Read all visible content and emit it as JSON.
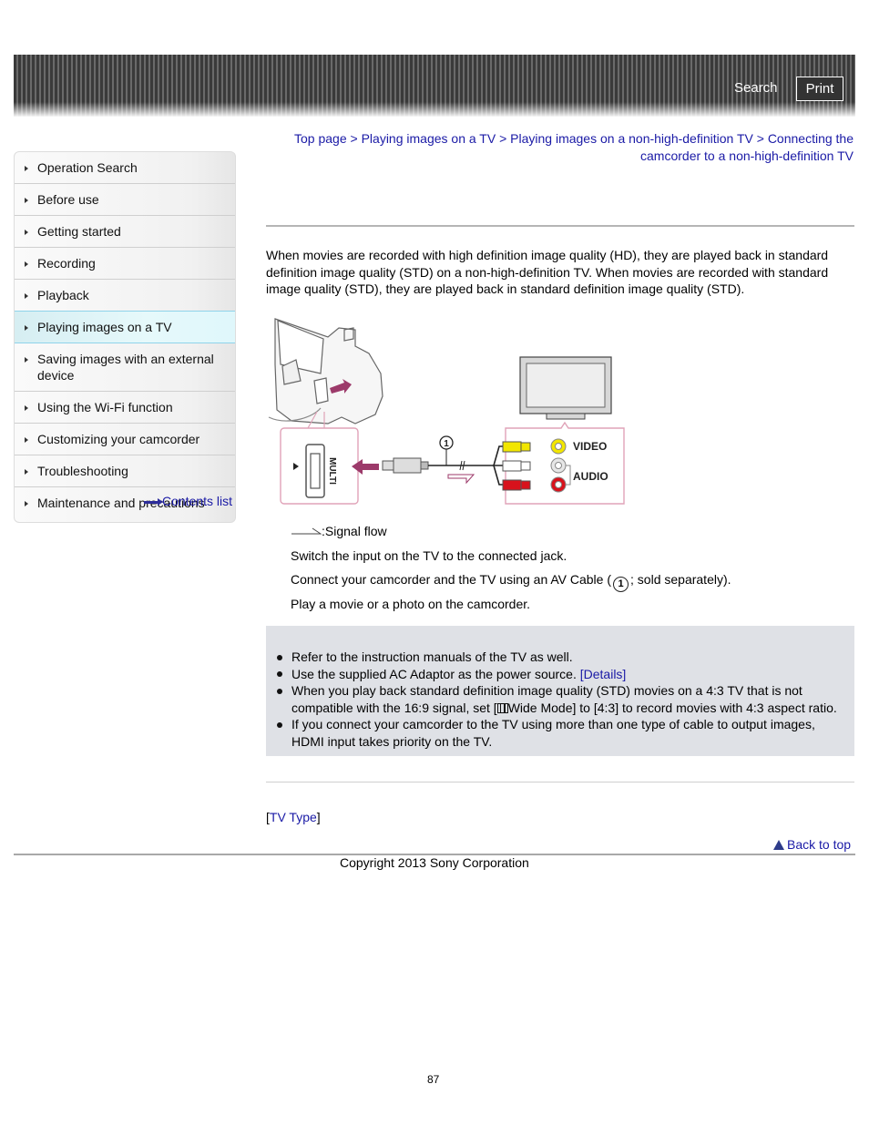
{
  "header": {
    "search_label": "Search",
    "print_label": "Print"
  },
  "sidebar": {
    "items": [
      {
        "label": "Operation Search",
        "active": false
      },
      {
        "label": "Before use",
        "active": false
      },
      {
        "label": "Getting started",
        "active": false
      },
      {
        "label": "Recording",
        "active": false
      },
      {
        "label": "Playback",
        "active": false
      },
      {
        "label": "Playing images on a TV",
        "active": true
      },
      {
        "label": "Saving images with an external device",
        "active": false
      },
      {
        "label": "Using the Wi-Fi function",
        "active": false
      },
      {
        "label": "Customizing your camcorder",
        "active": false
      },
      {
        "label": "Troubleshooting",
        "active": false
      },
      {
        "label": "Maintenance and precautions",
        "active": false
      }
    ],
    "contents_list_label": "Contents list"
  },
  "breadcrumb": {
    "items": [
      "Top page",
      "Playing images on a TV",
      "Playing images on a non-high-definition TV",
      "Connecting the camcorder to a non-high-definition TV"
    ],
    "separator": " > "
  },
  "intro": "When movies are recorded with high definition image quality (HD), they are played back in standard definition image quality (STD) on a non-high-definition TV. When movies are recorded with standard image quality (STD), they are played back in standard definition image quality (STD).",
  "diagram": {
    "port_label": "MULTI",
    "cable_number": "1",
    "video_label": "VIDEO",
    "audio_label": "AUDIO",
    "colors": {
      "accent": "#9c3a6a",
      "yellow": "#f2e600",
      "red": "#d8121c",
      "frame": "#e0a3b8"
    }
  },
  "signal_flow_label": ":Signal flow",
  "steps": [
    "Switch the input on the TV to the connected jack.",
    {
      "before": "Connect your camcorder and the TV using an AV Cable (",
      "icon": "1",
      "after": "; sold separately)."
    },
    "Play a movie or a photo on the camcorder."
  ],
  "notes": {
    "items": [
      {
        "text": "Refer to the instruction manuals of the TV as well."
      },
      {
        "text": "Use the supplied AC Adaptor as the power source. ",
        "link": "[Details]"
      },
      {
        "before": "When you play back standard definition image quality (STD) movies on a 4:3 TV that is not compatible with the 16:9 signal, set [",
        "after": "Wide Mode] to [4:3] to record movies with 4:3 aspect ratio."
      },
      {
        "text": "If you connect your camcorder to the TV using more than one type of cable to output images, HDMI input takes priority on the TV."
      }
    ]
  },
  "related": {
    "open": "[",
    "link": "TV Type",
    "close": "]"
  },
  "back_to_top_label": "Back to top",
  "copyright": "Copyright 2013 Sony Corporation",
  "page_number": "87"
}
